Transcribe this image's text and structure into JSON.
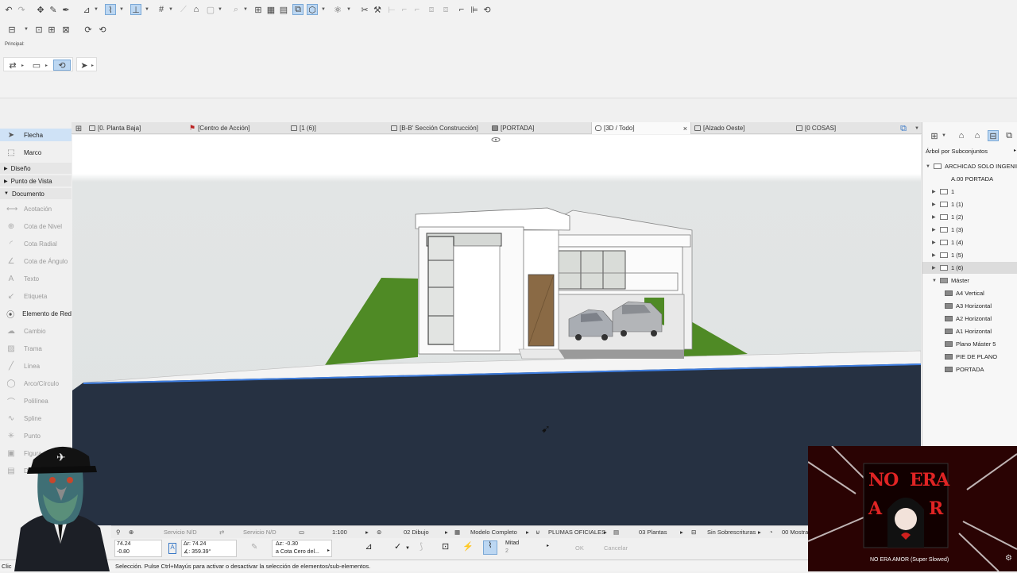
{
  "toolbar": {
    "icons": [
      "undo-icon",
      "redo-icon",
      "pick-icon",
      "eyedropper-icon",
      "inject-icon",
      "snap-guides-icon",
      "snap-points-icon",
      "gravity-icon",
      "grid-icon",
      "measure-icon",
      "renovation-icon",
      "lock-icon",
      "group-icon",
      "sketch-icon",
      "filter-icon",
      "3d-style-icon",
      "layer-icon",
      "trace-icon",
      "magic-wand-icon",
      "navigator-icon",
      "orbit-icon",
      "section-icon",
      "elevation-icon"
    ]
  },
  "principal_label": "Principal:",
  "tabs": [
    {
      "label": "[0. Planta Baja]"
    },
    {
      "label": "[Centro de Acción]"
    },
    {
      "label": "[1 (6)]"
    },
    {
      "label": "[B-B' Sección Construcción]"
    },
    {
      "label": "[PORTADA]"
    },
    {
      "label": "[3D / Todo]",
      "active": true
    },
    {
      "label": "[Alzado Oeste]"
    },
    {
      "label": "[0 COSAS]"
    }
  ],
  "left_panel": {
    "flecha": "Flecha",
    "marco": "Marco",
    "sections": [
      "Diseño",
      "Punto de Vista",
      "Documento"
    ],
    "tools": [
      "Acotación",
      "Cota de Nivel",
      "Cota Radial",
      "Cota de Ángulo",
      "Texto",
      "Etiqueta",
      "Elemento de Red",
      "Cambio",
      "Trama",
      "Línea",
      "Arco/Círculo",
      "Polilínea",
      "Spline",
      "Punto",
      "Figura",
      "Dibujo"
    ]
  },
  "right_panel": {
    "dropdown": "Árbol por Subconjuntos",
    "root": "ARCHICAD SOLO INGENIER",
    "items": [
      "A.00 PORTADA",
      "1",
      "1 (1)",
      "1 (2)",
      "1 (3)",
      "1 (4)",
      "1 (5)",
      "1 (6)"
    ],
    "master_folder": "Máster",
    "masters": [
      "A4 Vertical",
      "A3 Horizontal",
      "A2 Horizontal",
      "A1 Horizontal",
      "Plano Máster 5",
      "PIE DE PLANO",
      "PORTADA"
    ]
  },
  "infobar": {
    "servicio1": "Servicio N/D",
    "servicio2": "Servicio N/D",
    "scale": "1:100",
    "dibujo": "02 Dibujo",
    "modelo": "Modelo Completo",
    "plumas": "PLUMAS OFICIALES",
    "plantas": "03 Plantas",
    "sobrescrituras": "Sin Sobrescrituras",
    "mostrar": "00 Mostra"
  },
  "coords": {
    "x": "74.24",
    "y": "-0.80",
    "dr": "Δr: 74.24",
    "angle": "∡: 359.39°",
    "dz": "Δz: -0.30",
    "ref": "a Cota Cero del...",
    "mitad": "Mitad",
    "mitad_n": "2",
    "ok": "OK",
    "cancel": "Cancelar"
  },
  "status": {
    "left": "Clic",
    "text": "Selección. Pulse Ctrl+Mayús para activar o desactivar la selección de elementos/sub-elementos."
  },
  "media": {
    "cover_text_1": "NO",
    "cover_text_2": "ERA",
    "cover_text_3": "A",
    "cover_text_4": "R",
    "track": "NO ERA AMOR (Super Slowed)"
  },
  "colors": {
    "selection": "#cfe2f6",
    "ground": "#263142",
    "grass": "#4f8a25",
    "door": "#8a6a45"
  }
}
